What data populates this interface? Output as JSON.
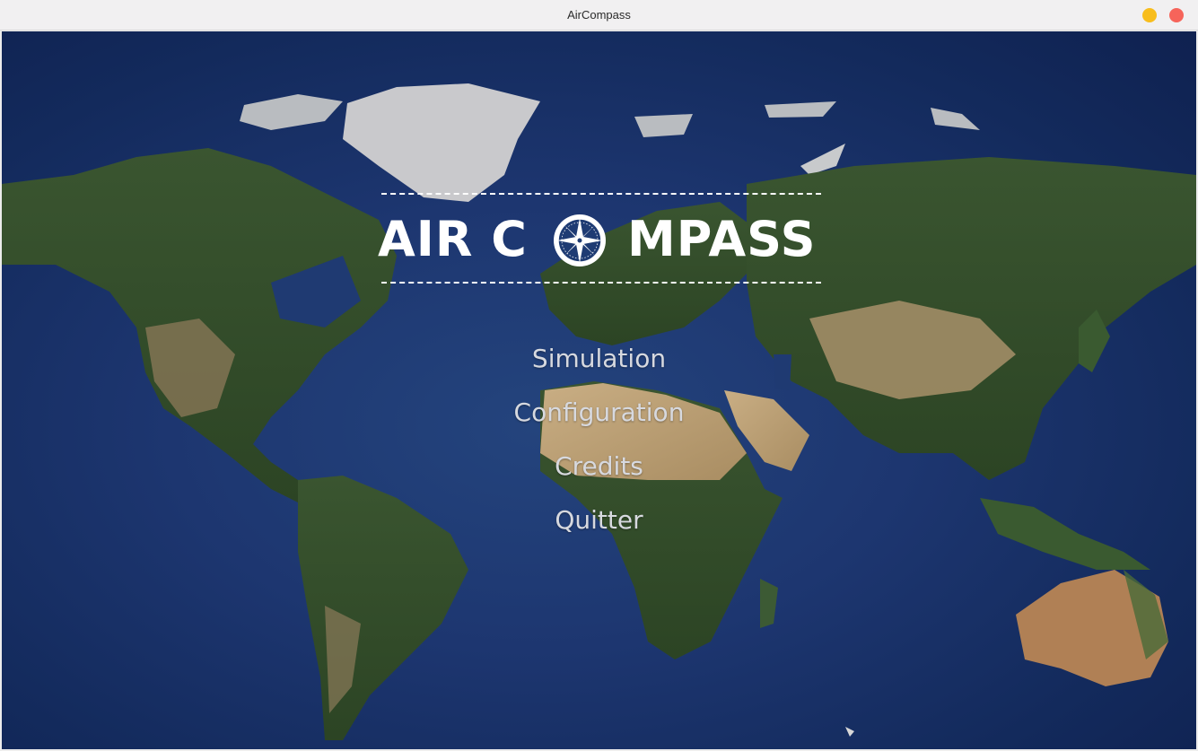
{
  "window": {
    "title": "AirCompass",
    "controls": [
      "minimize",
      "close"
    ],
    "colors": {
      "minimize": "#f8bd1c",
      "close": "#f6645a"
    }
  },
  "background": {
    "image": "world-map-satellite"
  },
  "logo": {
    "text_left": "AIR C",
    "text_right": "MPASS",
    "icon": "compass-rose-icon"
  },
  "menu": {
    "items": [
      {
        "label": "Simulation"
      },
      {
        "label": "Configuration"
      },
      {
        "label": "Credits"
      },
      {
        "label": "Quitter"
      }
    ]
  }
}
